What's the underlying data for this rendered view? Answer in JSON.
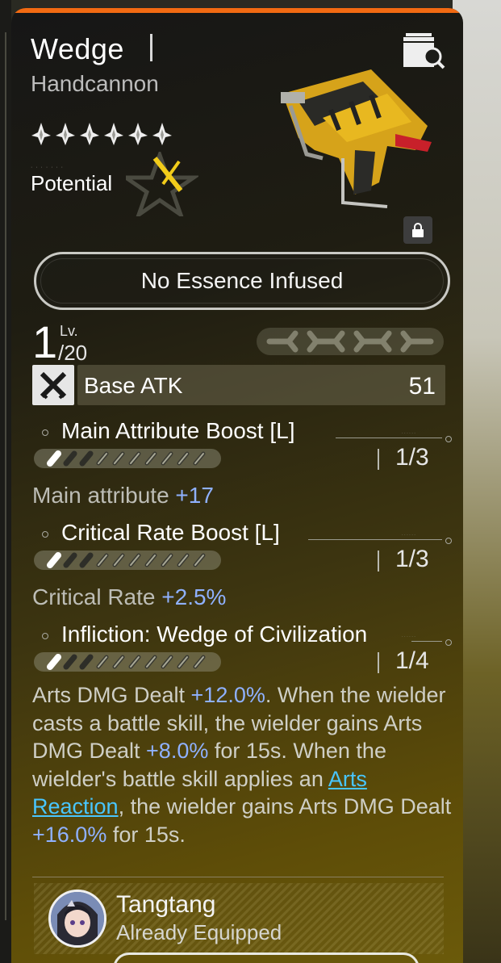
{
  "weapon": {
    "name": "Wedge",
    "type": "Handcannon",
    "rarity_stars": 6,
    "potential_label": "Potential"
  },
  "essence": {
    "label": "No Essence Infused"
  },
  "level": {
    "current": "1",
    "label": "Lv.",
    "max": "/20"
  },
  "base_atk": {
    "label": "Base ATK",
    "value": "51"
  },
  "attributes": [
    {
      "name": "Main Attribute Boost [L]",
      "count": "1/3",
      "filled": 1,
      "effect_label": "Main attribute",
      "effect_value": "+17"
    },
    {
      "name": "Critical Rate Boost [L]",
      "count": "1/3",
      "filled": 1,
      "effect_label": "Critical Rate",
      "effect_value": "+2.5%"
    },
    {
      "name": "Infliction: Wedge of Civilization",
      "count": "1/4",
      "filled": 1
    }
  ],
  "skill_desc": {
    "p1": "Arts DMG Dealt ",
    "v1": "+12.0%",
    "p2": ". When the wielder casts a battle skill, the wielder gains Arts DMG Dealt ",
    "v2": "+8.0%",
    "p3": " for 15s. When the wielder's battle skill applies an ",
    "link": "Arts Reaction",
    "p4": ", the wielder gains Arts DMG Dealt ",
    "v3": "+16.0%",
    "p5": " for 15s."
  },
  "equipped": {
    "name": "Tangtang",
    "status": "Already Equipped"
  },
  "colors": {
    "accent_top": "#f26a12",
    "highlight_value": "#8fb1ff",
    "link": "#48c6ff"
  },
  "icons": {
    "archive": "archive-search-icon",
    "lock": "lock-icon",
    "atk": "crossed-swords-icon"
  }
}
